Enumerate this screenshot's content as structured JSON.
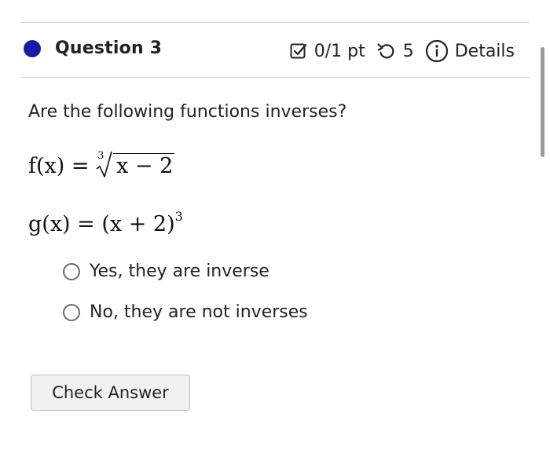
{
  "question": {
    "title": "Question 3",
    "points": "0/1 pt",
    "attempts": "5",
    "details_label": "Details"
  },
  "prompt": "Are the following functions inverses?",
  "functions": {
    "f": {
      "lhs": "f(x) = ",
      "root_index": "3",
      "radicand": "x − 2"
    },
    "g": {
      "lhs": "g(x) = (x + 2)",
      "exponent": "3"
    }
  },
  "options": [
    {
      "label": "Yes, they are inverse"
    },
    {
      "label": "No, they are not inverses"
    }
  ],
  "check_button": "Check Answer",
  "colors": {
    "status_dot": "#1a1aa6"
  }
}
